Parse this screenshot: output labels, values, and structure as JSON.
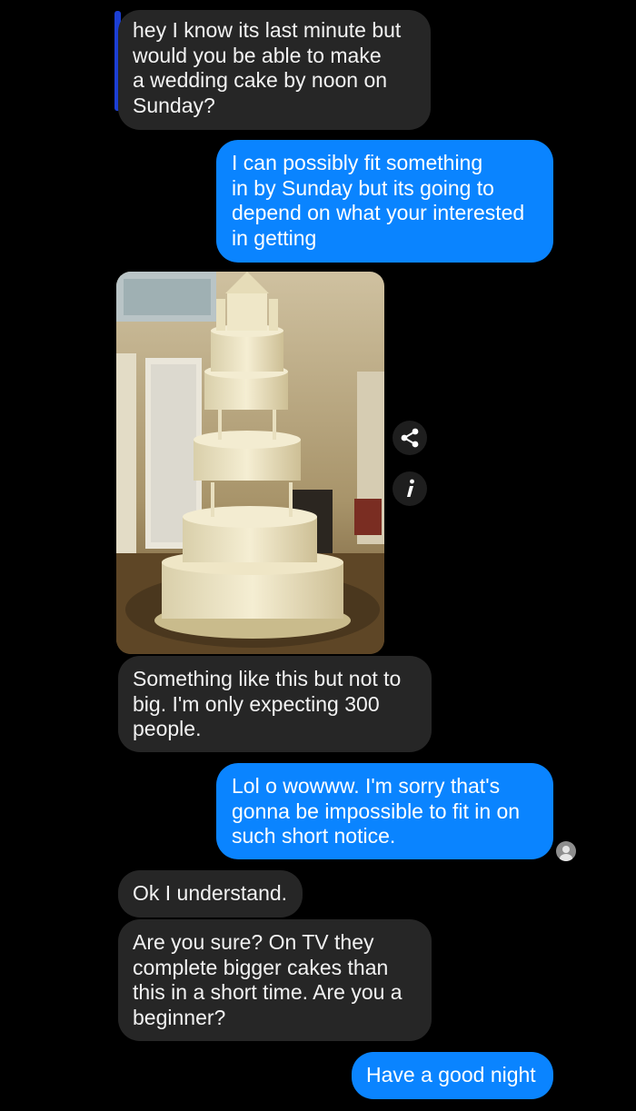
{
  "conversation": {
    "messages": [
      {
        "sender": "them",
        "text": "hey I know its last minute but\nwould you be able to make\na wedding cake by noon on\nSunday?"
      },
      {
        "sender": "me",
        "text": "I can possibly fit something\nin by Sunday but its going to\ndepend on what your interested\nin getting"
      },
      {
        "sender": "them",
        "type": "image",
        "icon": "wedding-cake-photo"
      },
      {
        "sender": "them",
        "text": "Something like this but not to\nbig. I'm only expecting 300\npeople."
      },
      {
        "sender": "me",
        "text": "Lol o wowww. I'm sorry that's\ngonna be impossible to fit in on\nsuch short notice."
      },
      {
        "sender": "them",
        "text": "Ok I understand."
      },
      {
        "sender": "them",
        "text": "Are you sure?  On TV they\ncomplete bigger cakes than\nthis in a short time. Are you a\nbeginner?"
      },
      {
        "sender": "me",
        "text": "Have a good night"
      }
    ]
  },
  "image_actions": {
    "share_icon": "share-icon",
    "info_icon": "info-icon"
  },
  "read_receipt_icon": "seen-avatar-icon",
  "colors": {
    "background": "#000000",
    "incoming_bubble": "#262626",
    "outgoing_bubble": "#0a84ff",
    "text": "#ffffff"
  }
}
